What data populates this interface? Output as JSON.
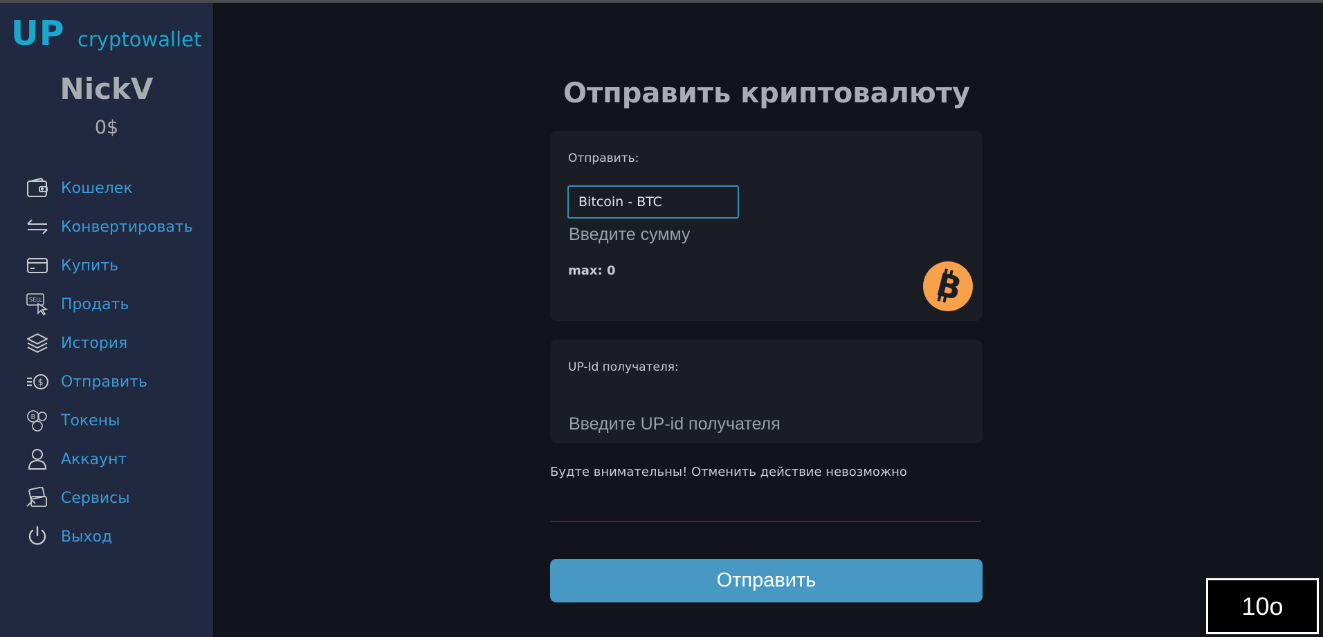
{
  "app": {
    "logo_up": "UP",
    "logo_text": "cryptowallet",
    "accent": "#1aa6cf"
  },
  "user": {
    "name": "NickV",
    "balance": "0$"
  },
  "sidebar": {
    "items": [
      {
        "label": "Кошелек",
        "icon": "wallet-icon"
      },
      {
        "label": "Конвертировать",
        "icon": "convert-arrows-icon"
      },
      {
        "label": "Купить",
        "icon": "credit-card-icon"
      },
      {
        "label": "Продать",
        "icon": "sell-sign-icon"
      },
      {
        "label": "История",
        "icon": "layers-icon"
      },
      {
        "label": "Отправить",
        "icon": "send-coin-icon"
      },
      {
        "label": "Токены",
        "icon": "tokens-icon"
      },
      {
        "label": "Аккаунт",
        "icon": "user-icon"
      },
      {
        "label": "Сервисы",
        "icon": "services-icon"
      },
      {
        "label": "Выход",
        "icon": "power-icon"
      }
    ]
  },
  "main": {
    "title": "Отправить криптовалюту",
    "send_label": "Отправить:",
    "currency_selected": "Bitcoin - BTC",
    "amount_placeholder": "Введите сумму",
    "max_text": "max: 0",
    "coin_icon": "bitcoin-coin-icon",
    "recipient_label": "UP-Id получателя:",
    "recipient_placeholder": "Введите UP-id получателя",
    "warning": "Будте внимательны! Отменить действие невозможно",
    "submit_label": "Отправить"
  },
  "overlay": {
    "badge_text": "10о"
  },
  "colors": {
    "sidebar_bg": "#212940",
    "main_bg": "#11141b",
    "card_bg": "#1a1d24",
    "nav_text": "#3b9ad6",
    "button_bg": "#4799c3",
    "bitcoin": "#f7a24b",
    "danger_line": "#b3262b"
  }
}
